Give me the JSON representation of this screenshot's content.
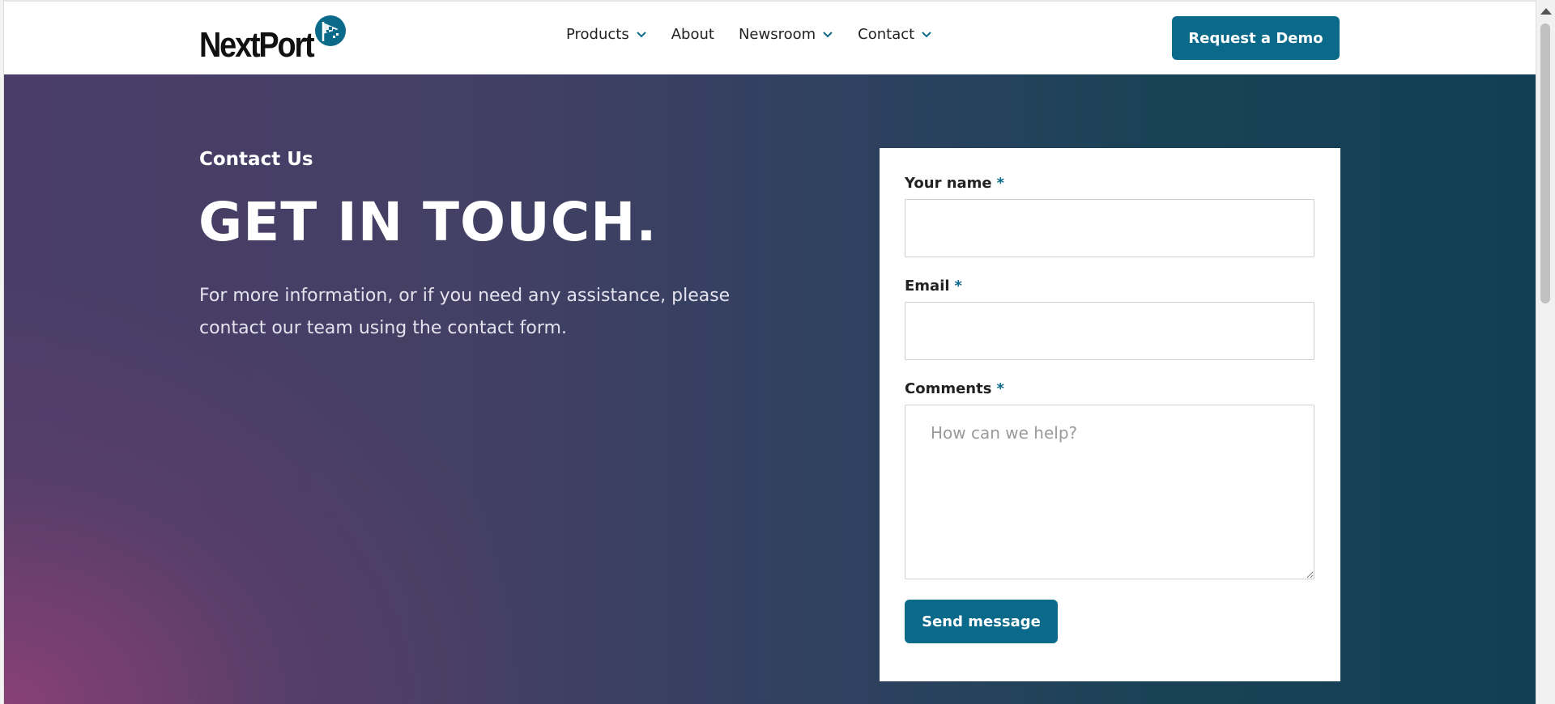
{
  "header": {
    "logo_text": "NextPort",
    "nav": [
      {
        "label": "Products",
        "dropdown": true
      },
      {
        "label": "About",
        "dropdown": false
      },
      {
        "label": "Newsroom",
        "dropdown": true
      },
      {
        "label": "Contact",
        "dropdown": true
      }
    ],
    "demo_label": "Request a Demo"
  },
  "hero": {
    "eyebrow": "Contact Us",
    "headline": "GET IN TOUCH.",
    "intro": "For more information, or if you need any assistance, please contact our team using the contact form."
  },
  "form": {
    "name_label": "Your name",
    "email_label": "Email",
    "comments_label": "Comments",
    "required_mark": "*",
    "name_value": "",
    "email_value": "",
    "comments_placeholder": "How can we help?",
    "submit_label": "Send message"
  },
  "colors": {
    "accent": "#0b6a8a",
    "gradient_left": "#8c4076",
    "gradient_right": "#113f54"
  }
}
